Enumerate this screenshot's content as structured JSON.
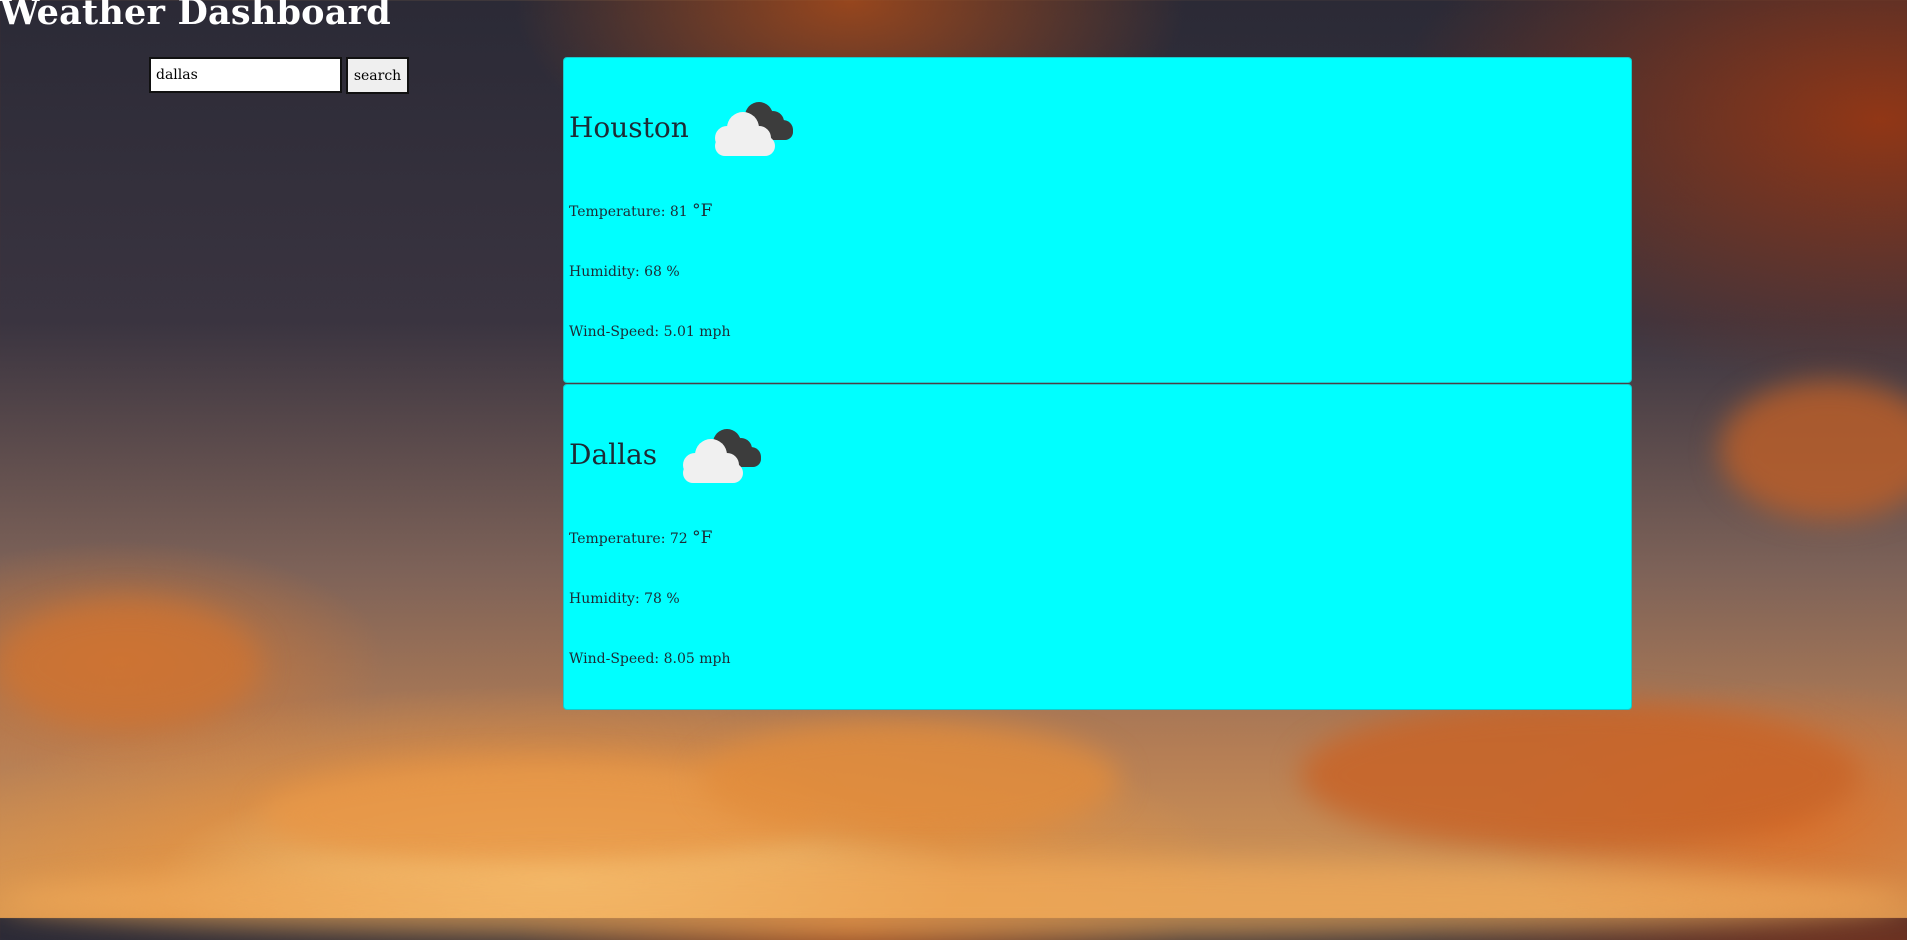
{
  "header": {
    "title": "Weather Dashboard"
  },
  "search": {
    "value": "dallas",
    "button_label": "search"
  },
  "cards": [
    {
      "city": "Houston",
      "icon": "cloudy-icon",
      "temperature_label": "Temperature: 81 ",
      "temperature_unit": "°F",
      "humidity": "Humidity: 68 %",
      "wind": "Wind-Speed: 5.01 mph"
    },
    {
      "city": "Dallas",
      "icon": "cloudy-icon",
      "temperature_label": "Temperature: 72 ",
      "temperature_unit": "°F",
      "humidity": "Humidity: 78 %",
      "wind": "Wind-Speed: 8.05 mph"
    }
  ],
  "colors": {
    "card_bg": "#00ffff",
    "title": "#ffffff",
    "text": "#1d2b35"
  }
}
